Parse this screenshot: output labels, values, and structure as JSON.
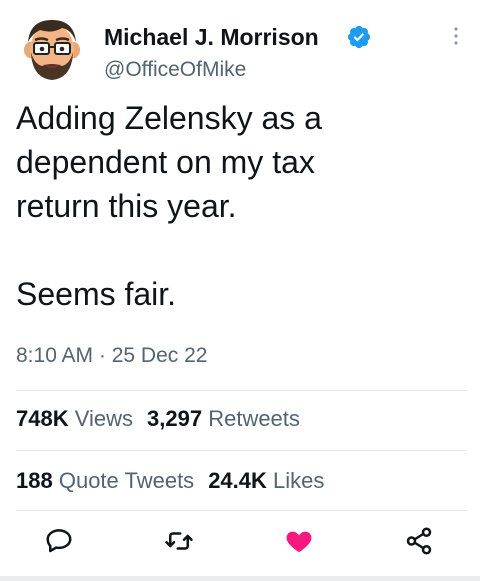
{
  "author": {
    "name": "Michael J. Morrison",
    "handle": "@OfficeOfMike",
    "verified": true,
    "avatar": "bitmoji-avatar-icon"
  },
  "tweet": {
    "text": "Adding Zelensky as a\ndependent on my tax\nreturn this year.\n\nSeems fair.",
    "time": "8:10 AM",
    "date": "25 Dec 22"
  },
  "stats": {
    "views_value": "748K",
    "views_label": "Views",
    "retweets_value": "3,297",
    "retweets_label": "Retweets",
    "quotes_value": "188",
    "quotes_label": "Quote Tweets",
    "likes_value": "24.4K",
    "likes_label": "Likes"
  },
  "actions": [
    "reply-icon",
    "retweet-icon",
    "like-icon",
    "share-icon"
  ],
  "colors": {
    "text": "#0f1419",
    "secondary": "#536471",
    "verified": "#1d9bf0",
    "like": "#f91880",
    "divider": "#e1e8ed"
  }
}
